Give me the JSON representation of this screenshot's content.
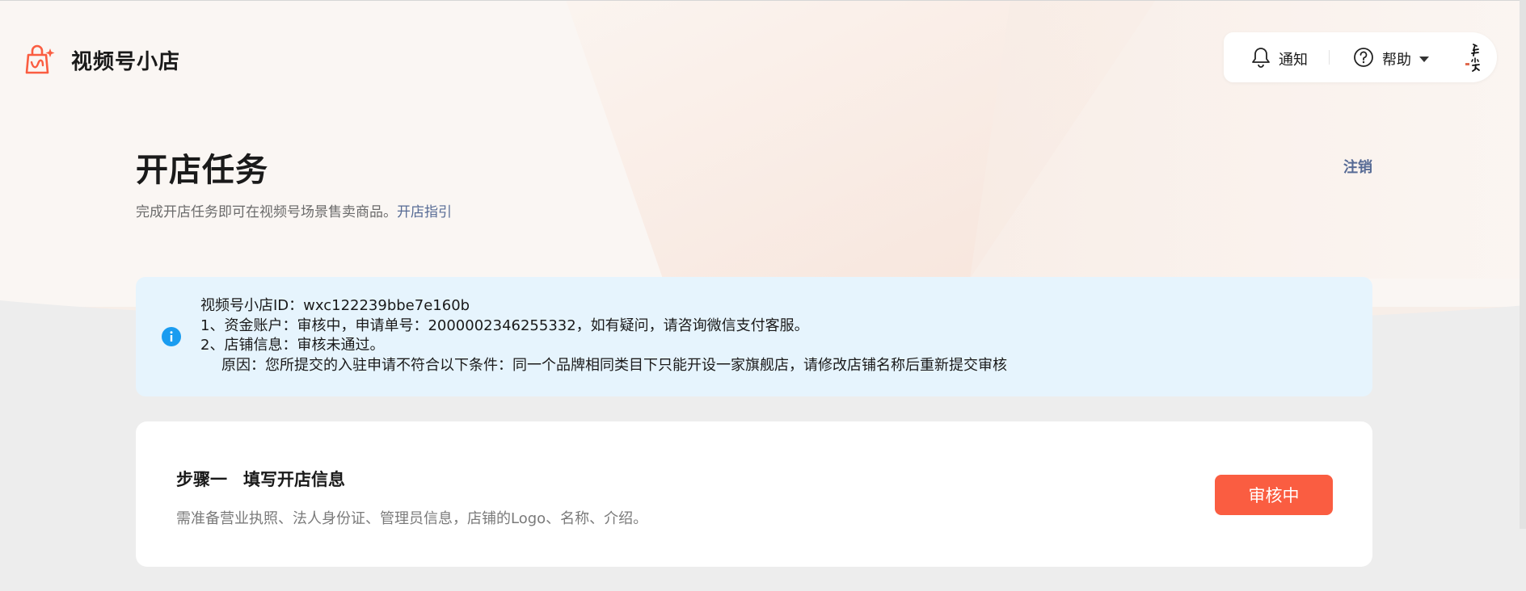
{
  "brand": {
    "name": "视频号小店",
    "logo_icon": "shop-bag-icon"
  },
  "top_actions": {
    "notify": {
      "label": "通知",
      "icon": "bell-icon"
    },
    "help": {
      "label": "帮助",
      "icon": "question-circle-icon"
    },
    "avatar": "avatar"
  },
  "page": {
    "title": "开店任务",
    "desc_prefix": "完成开店任务即可在视频号场景售卖商品。",
    "desc_link": "开店指引",
    "logout": "注销"
  },
  "notice": {
    "lines": [
      "视频号小店ID：wxc122239bbe7e160b",
      "1、资金账户：审核中，申请单号：2000002346255332，如有疑问，请咨询微信支付客服。",
      "2、店铺信息：审核未通过。",
      "原因：您所提交的入驻申请不符合以下条件：同一个品牌相同类目下只能开设一家旗舰店，请修改店铺名称后重新提交审核"
    ],
    "icon": "info-icon"
  },
  "step": {
    "step_no": "步骤一",
    "title": "填写开店信息",
    "desc": "需准备营业执照、法人身份证、管理员信息，店铺的Logo、名称、介绍。",
    "status": "审核中"
  },
  "colors": {
    "accent_link": "#576b95",
    "status_button": "#fa5d41",
    "notice_bg": "#e6f4fd",
    "info_icon": "#1a9cf0",
    "brand_logo": "#fa5d41"
  }
}
